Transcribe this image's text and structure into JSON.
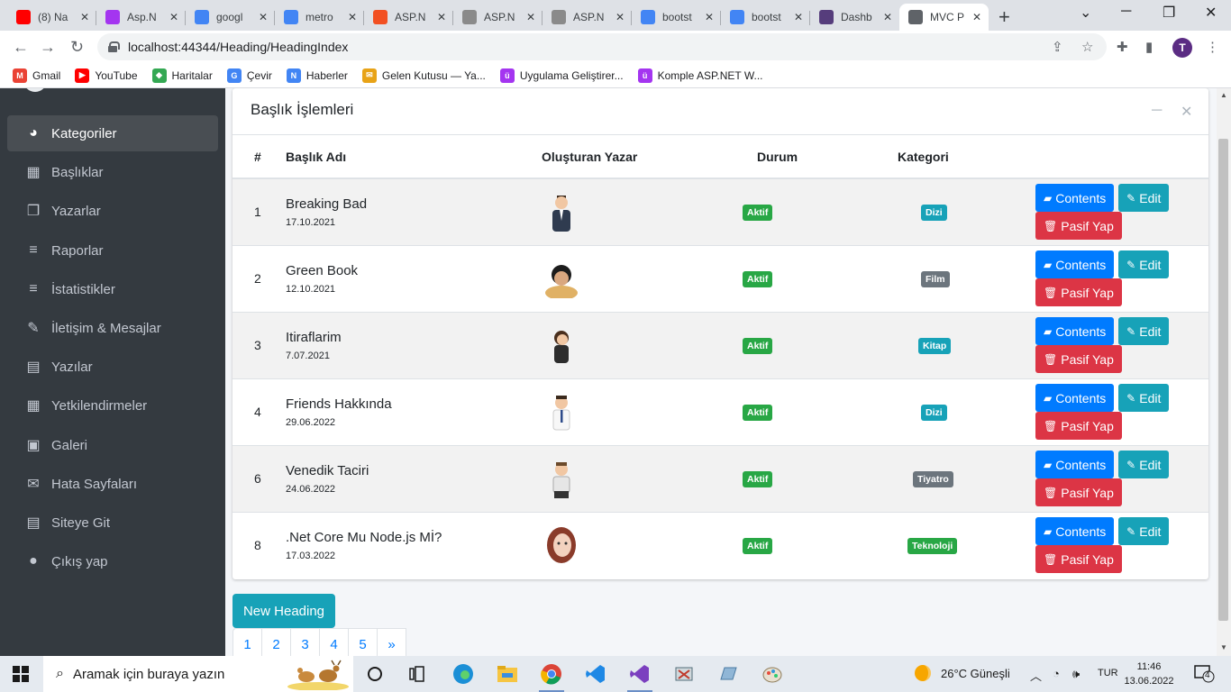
{
  "browser": {
    "tabs": [
      {
        "title": "(8) Na",
        "icon": "youtube-icon",
        "color": "#ff0000"
      },
      {
        "title": "Asp.N",
        "icon": "udemy-icon",
        "color": "#a435f0"
      },
      {
        "title": "googl",
        "icon": "google-icon",
        "color": "#4285f4"
      },
      {
        "title": "metro",
        "icon": "google-icon",
        "color": "#4285f4"
      },
      {
        "title": "ASP.N",
        "icon": "microsoft-icon",
        "color": "#f25022"
      },
      {
        "title": "ASP.N",
        "icon": "asp-icon",
        "color": "#8a8a8a"
      },
      {
        "title": "ASP.N",
        "icon": "asp-icon",
        "color": "#8a8a8a"
      },
      {
        "title": "bootst",
        "icon": "google-icon",
        "color": "#4285f4"
      },
      {
        "title": "bootst",
        "icon": "google-icon",
        "color": "#4285f4"
      },
      {
        "title": "Dashb",
        "icon": "bootstrap-icon",
        "color": "#563d7c"
      },
      {
        "title": "MVC P",
        "icon": "page-icon",
        "color": "#5f6368"
      }
    ],
    "url": "localhost:44344/Heading/HeadingIndex",
    "profile_initial": "T",
    "bookmarks": [
      {
        "label": "Gmail",
        "color": "#ea4335",
        "glyph": "M"
      },
      {
        "label": "YouTube",
        "color": "#ff0000",
        "glyph": "▶"
      },
      {
        "label": "Haritalar",
        "color": "#34a853",
        "glyph": "◆"
      },
      {
        "label": "Çevir",
        "color": "#4285f4",
        "glyph": "G"
      },
      {
        "label": "Haberler",
        "color": "#4285f4",
        "glyph": "N"
      },
      {
        "label": "Gelen Kutusu — Ya...",
        "color": "#e8a317",
        "glyph": "✉"
      },
      {
        "label": "Uygulama Geliştirer...",
        "color": "#a435f0",
        "glyph": "ü"
      },
      {
        "label": "Komple ASP.NET W...",
        "color": "#a435f0",
        "glyph": "ü"
      }
    ]
  },
  "sidebar": {
    "items": [
      {
        "label": "Kategoriler",
        "icon": "dashboard-icon",
        "glyph": "◕",
        "active": true
      },
      {
        "label": "Başlıklar",
        "icon": "grid-icon",
        "glyph": "▦",
        "active": false
      },
      {
        "label": "Yazarlar",
        "icon": "copy-icon",
        "glyph": "❐",
        "active": false
      },
      {
        "label": "Raporlar",
        "icon": "bars-icon",
        "glyph": "≡",
        "active": false
      },
      {
        "label": "İstatistikler",
        "icon": "bars-icon",
        "glyph": "≡",
        "active": false
      },
      {
        "label": "İletişim & Mesajlar",
        "icon": "edit-icon",
        "glyph": "✎",
        "active": false
      },
      {
        "label": "Yazılar",
        "icon": "table-icon",
        "glyph": "▤",
        "active": false
      },
      {
        "label": "Yetkilendirmeler",
        "icon": "calendar-icon",
        "glyph": "▦",
        "active": false
      },
      {
        "label": "Galeri",
        "icon": "image-icon",
        "glyph": "▣",
        "active": false
      },
      {
        "label": "Hata Sayfaları",
        "icon": "envelope-icon",
        "glyph": "✉",
        "active": false
      },
      {
        "label": "Siteye Git",
        "icon": "book-icon",
        "glyph": "▤",
        "active": false
      },
      {
        "label": "Çıkış yap",
        "icon": "apple-icon",
        "glyph": "●",
        "active": false
      }
    ]
  },
  "card": {
    "title": "Başlık İşlemleri",
    "columns": [
      "#",
      "Başlık Adı",
      "Oluşturan Yazar",
      "Durum",
      "Kategori",
      ""
    ],
    "rows": [
      {
        "id": "1",
        "name": "Breaking Bad",
        "date": "17.10.2021",
        "status": "Aktif",
        "category": "Dizi",
        "cat_color": "#17a2b8",
        "avatar": "man-suit"
      },
      {
        "id": "2",
        "name": "Green Book",
        "date": "12.10.2021",
        "status": "Aktif",
        "category": "Film",
        "cat_color": "#6c757d",
        "avatar": "woman-dark"
      },
      {
        "id": "3",
        "name": "Itiraflarim",
        "date": "7.07.2021",
        "status": "Aktif",
        "category": "Kitap",
        "cat_color": "#17a2b8",
        "avatar": "woman-thinking"
      },
      {
        "id": "4",
        "name": "Friends Hakkında",
        "date": "29.06.2022",
        "status": "Aktif",
        "category": "Dizi",
        "cat_color": "#17a2b8",
        "avatar": "man-shirt"
      },
      {
        "id": "6",
        "name": "Venedik Taciri",
        "date": "24.06.2022",
        "status": "Aktif",
        "category": "Tiyatro",
        "cat_color": "#6c757d",
        "avatar": "man-casual"
      },
      {
        "id": "8",
        "name": ".Net Core Mu Node.js Mİ?",
        "date": "17.03.2022",
        "status": "Aktif",
        "category": "Teknoloji",
        "cat_color": "#28a745",
        "avatar": "woman-red"
      }
    ],
    "buttons": {
      "contents": "Contents",
      "edit": "Edit",
      "passive": "Pasif Yap"
    }
  },
  "new_heading": "New Heading",
  "pagination": [
    "1",
    "2",
    "3",
    "4",
    "5",
    "»"
  ],
  "taskbar": {
    "search_placeholder": "Aramak için buraya yazın",
    "weather": "26°C  Güneşli",
    "language": "TUR",
    "time": "11:46",
    "date": "13.06.2022",
    "notifications": "4"
  }
}
